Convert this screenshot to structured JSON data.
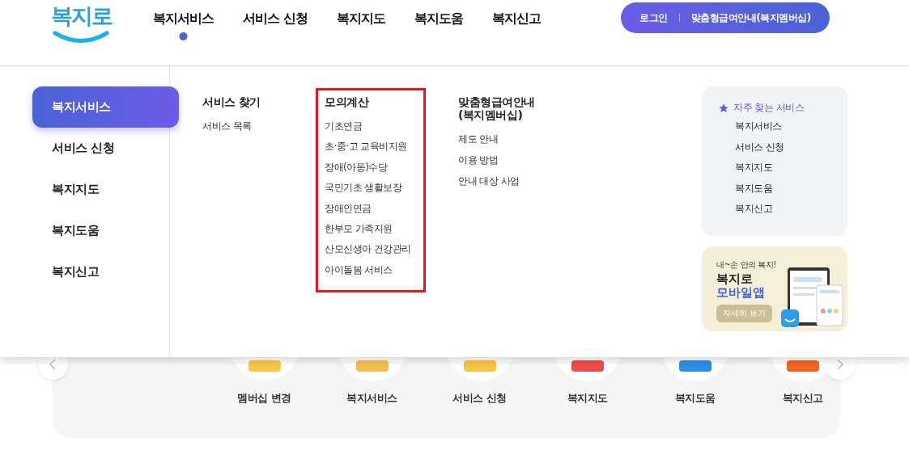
{
  "header": {
    "logo": "복지로",
    "nav": [
      {
        "label": "복지서비스",
        "selected": true
      },
      {
        "label": "서비스 신청",
        "selected": false
      },
      {
        "label": "복지지도",
        "selected": false
      },
      {
        "label": "복지도움",
        "selected": false
      },
      {
        "label": "복지신고",
        "selected": false
      }
    ],
    "actions": [
      "로그인",
      "맞춤형급여안내(복지멤버십)"
    ]
  },
  "mega_menu": {
    "sidebar": [
      {
        "label": "복지서비스",
        "selected": true
      },
      {
        "label": "서비스 신청",
        "selected": false
      },
      {
        "label": "복지지도",
        "selected": false
      },
      {
        "label": "복지도움",
        "selected": false
      },
      {
        "label": "복지신고",
        "selected": false
      }
    ],
    "columns": [
      {
        "title": "서비스 찾기",
        "highlighted": false,
        "items": [
          "서비스 목록"
        ]
      },
      {
        "title": "모의계산",
        "highlighted": true,
        "items": [
          "기초연금",
          "초·중·고 교육비지원",
          "장애(아동)수당",
          "국민기초 생활보장",
          "장애인연금",
          "한부모 가족지원",
          "산모신생아 건강관리",
          "아이돌봄 서비스"
        ]
      },
      {
        "title": "맞춤형급여안내\n(복지멤버십)",
        "highlighted": false,
        "items": [
          "제도 안내",
          "이용 방법",
          "안내 대상 사업"
        ]
      }
    ],
    "quick": {
      "title": "자주 찾는 서비스",
      "items": [
        "복지서비스",
        "서비스 신청",
        "복지지도",
        "복지도움",
        "복지신고"
      ]
    },
    "banner": {
      "tagline": "내~손 안의 복지!",
      "title": "복지로",
      "subtitle": "모바일앱",
      "button": "자세히 보기"
    }
  },
  "shortcuts": [
    {
      "label": "멤버십 변경",
      "color": "#f7c948"
    },
    {
      "label": "복지서비스",
      "color": "#f2c14e"
    },
    {
      "label": "서비스 신청",
      "color": "#f5c542"
    },
    {
      "label": "복지지도",
      "color": "#ef4b4b"
    },
    {
      "label": "복지도움",
      "color": "#2d8ee8"
    },
    {
      "label": "복지신고",
      "color": "#f26522"
    }
  ]
}
